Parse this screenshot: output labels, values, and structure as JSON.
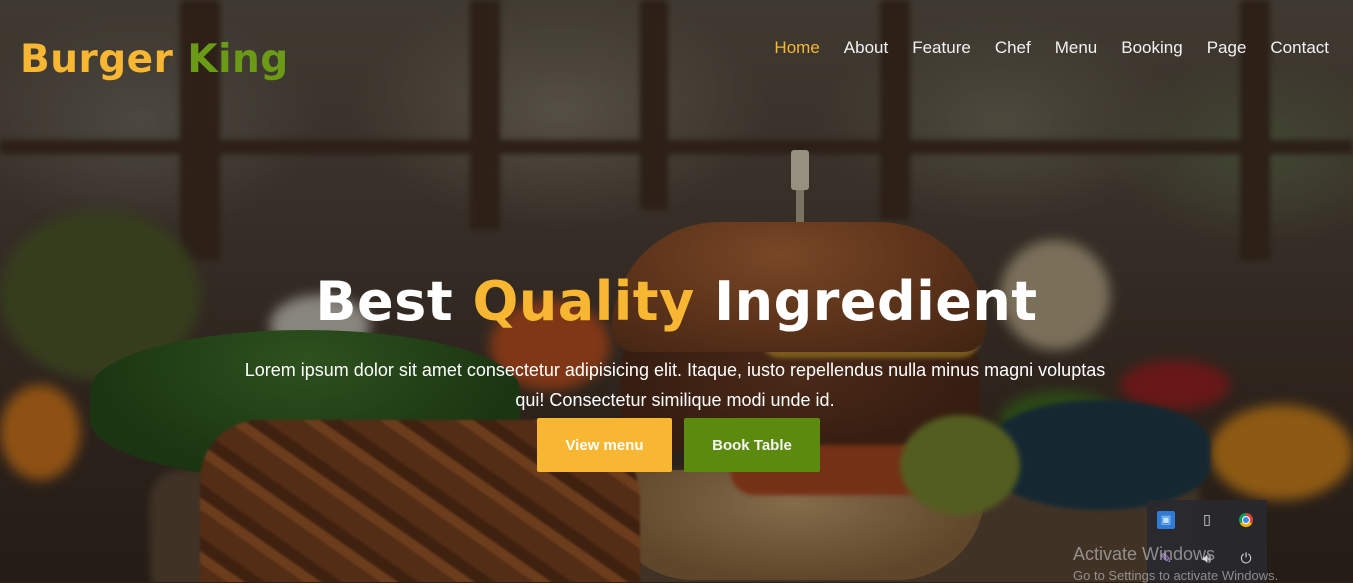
{
  "brand": {
    "part1": "Burger",
    "part2": "King"
  },
  "nav": {
    "items": [
      "Home",
      "About",
      "Feature",
      "Chef",
      "Menu",
      "Booking",
      "Page",
      "Contact"
    ],
    "active": "Home"
  },
  "hero": {
    "title_part1": "Best",
    "title_accent": "Quality",
    "title_part2": "Ingredient",
    "description": "Lorem ipsum dolor sit amet consectetur adipisicing elit. Itaque, iusto repellendus nulla minus magni voluptas qui! Consectetur similique modi unde id.",
    "btn_view_menu": "View menu",
    "btn_book_table": "Book Table"
  },
  "colors": {
    "accent_yellow": "#f7b733",
    "accent_green": "#5b8a0e"
  },
  "os_overlay": {
    "watermark_title": "Activate Windows",
    "watermark_sub": "Go to Settings to activate Windows.",
    "tray_icons": [
      "network-settings-icon",
      "usb-drive-icon",
      "chrome-icon",
      "pen-icon",
      "volume-icon",
      "power-icon"
    ]
  }
}
